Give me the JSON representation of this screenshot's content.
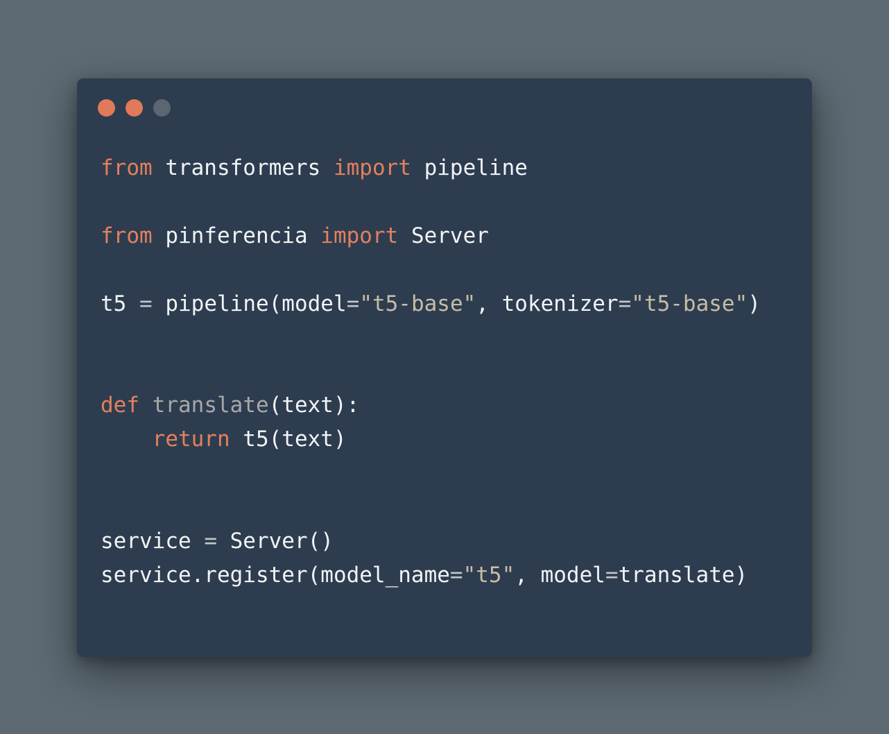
{
  "colors": {
    "background": "#5d6a73",
    "window": "#2d3d4f",
    "keyword": "#e3805f",
    "string": "#c7bca8",
    "function_name": "#a6a8a8",
    "operator": "#c3c6cb",
    "default_text": "#f2f3f5",
    "dot_red": "#e07a5a",
    "dot_orange": "#e07a5a",
    "dot_gray": "#5b6672"
  },
  "window_controls": [
    {
      "name": "close-button-icon",
      "color": "#e07a5a"
    },
    {
      "name": "minimize-button-icon",
      "color": "#e07a5a"
    },
    {
      "name": "maximize-button-icon",
      "color": "#5b6672"
    }
  ],
  "code": {
    "lines": [
      [
        {
          "t": "kw",
          "v": "from"
        },
        {
          "t": "txt",
          "v": " transformers "
        },
        {
          "t": "kw",
          "v": "import"
        },
        {
          "t": "txt",
          "v": " pipeline"
        }
      ],
      [],
      [
        {
          "t": "kw",
          "v": "from"
        },
        {
          "t": "txt",
          "v": " pinferencia "
        },
        {
          "t": "kw",
          "v": "import"
        },
        {
          "t": "txt",
          "v": " Server"
        }
      ],
      [],
      [
        {
          "t": "txt",
          "v": "t5 "
        },
        {
          "t": "op",
          "v": "="
        },
        {
          "t": "txt",
          "v": " pipeline(model"
        },
        {
          "t": "op",
          "v": "="
        },
        {
          "t": "str",
          "v": "\"t5-base\""
        },
        {
          "t": "txt",
          "v": ", tokenizer"
        },
        {
          "t": "op",
          "v": "="
        },
        {
          "t": "str",
          "v": "\"t5-base\""
        },
        {
          "t": "txt",
          "v": ")"
        }
      ],
      [],
      [],
      [
        {
          "t": "kw",
          "v": "def"
        },
        {
          "t": "txt",
          "v": " "
        },
        {
          "t": "fn",
          "v": "translate"
        },
        {
          "t": "txt",
          "v": "(text):"
        }
      ],
      [
        {
          "t": "txt",
          "v": "    "
        },
        {
          "t": "kw",
          "v": "return"
        },
        {
          "t": "txt",
          "v": " t5(text)"
        }
      ],
      [],
      [],
      [
        {
          "t": "txt",
          "v": "service "
        },
        {
          "t": "op",
          "v": "="
        },
        {
          "t": "txt",
          "v": " Server()"
        }
      ],
      [
        {
          "t": "txt",
          "v": "service.register(model_name"
        },
        {
          "t": "op",
          "v": "="
        },
        {
          "t": "str",
          "v": "\"t5\""
        },
        {
          "t": "txt",
          "v": ", model"
        },
        {
          "t": "op",
          "v": "="
        },
        {
          "t": "txt",
          "v": "translate)"
        }
      ]
    ]
  }
}
